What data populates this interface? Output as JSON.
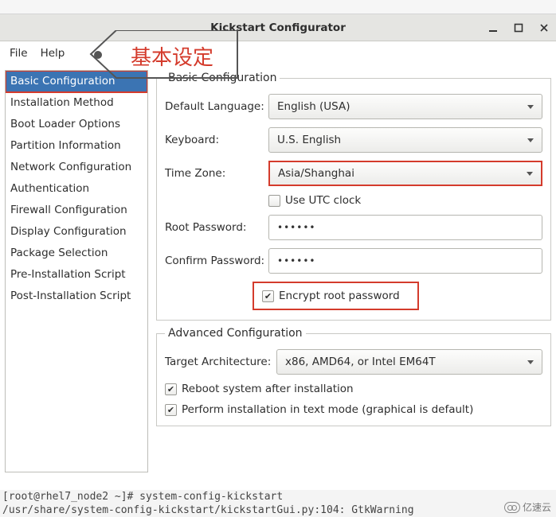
{
  "window": {
    "title": "Kickstart Configurator"
  },
  "menu": {
    "file": "File",
    "help": "Help"
  },
  "callout": {
    "text": "基本设定"
  },
  "sidebar": {
    "items": [
      {
        "label": "Basic Configuration",
        "selected": true,
        "highlight": true
      },
      {
        "label": "Installation Method"
      },
      {
        "label": "Boot Loader Options"
      },
      {
        "label": "Partition Information"
      },
      {
        "label": "Network Configuration"
      },
      {
        "label": "Authentication"
      },
      {
        "label": "Firewall Configuration"
      },
      {
        "label": "Display Configuration"
      },
      {
        "label": "Package Selection"
      },
      {
        "label": "Pre-Installation Script"
      },
      {
        "label": "Post-Installation Script"
      }
    ]
  },
  "basic": {
    "legend": "Basic Configuration",
    "default_language_label": "Default Language:",
    "default_language_value": "English (USA)",
    "keyboard_label": "Keyboard:",
    "keyboard_value": "U.S. English",
    "time_zone_label": "Time Zone:",
    "time_zone_value": "Asia/Shanghai",
    "use_utc_label": "Use UTC clock",
    "use_utc_checked": false,
    "root_pw_label": "Root Password:",
    "root_pw_value": "••••••",
    "confirm_pw_label": "Confirm Password:",
    "confirm_pw_value": "••••••",
    "encrypt_label": "Encrypt root password",
    "encrypt_checked": true
  },
  "advanced": {
    "legend": "Advanced Configuration",
    "target_arch_label": "Target Architecture:",
    "target_arch_value": "x86, AMD64, or Intel EM64T",
    "reboot_label": "Reboot system after installation",
    "reboot_checked": true,
    "textmode_label": "Perform installation in text mode (graphical is default)",
    "textmode_checked": true
  },
  "terminal": {
    "line1": "[root@rhel7_node2 ~]# system-config-kickstart",
    "line2": "/usr/share/system-config-kickstart/kickstartGui.py:104: GtkWarning"
  },
  "watermark": {
    "text": "亿速云"
  }
}
